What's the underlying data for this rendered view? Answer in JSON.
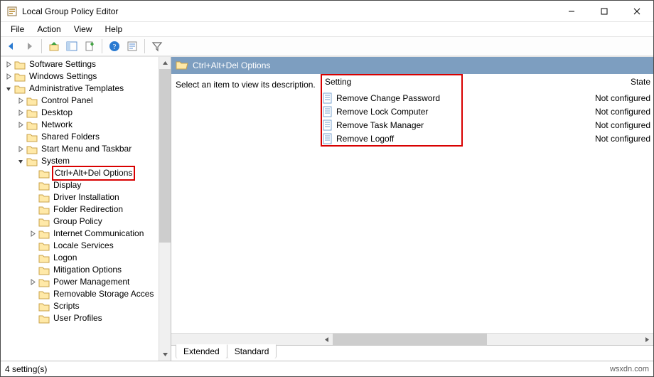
{
  "window": {
    "title": "Local Group Policy Editor"
  },
  "menu": {
    "file": "File",
    "action": "Action",
    "view": "View",
    "help": "Help"
  },
  "tree": {
    "software_settings": "Software Settings",
    "windows_settings": "Windows Settings",
    "admin_templates": "Administrative Templates",
    "control_panel": "Control Panel",
    "desktop": "Desktop",
    "network": "Network",
    "shared_folders": "Shared Folders",
    "start_menu_taskbar": "Start Menu and Taskbar",
    "system": "System",
    "ctrl_alt_del": "Ctrl+Alt+Del Options",
    "display": "Display",
    "driver_installation": "Driver Installation",
    "folder_redirection": "Folder Redirection",
    "group_policy": "Group Policy",
    "internet_comm": "Internet Communication",
    "locale_services": "Locale Services",
    "logon": "Logon",
    "mitigation_options": "Mitigation Options",
    "power_management": "Power Management",
    "removable_storage": "Removable Storage Acces",
    "scripts": "Scripts",
    "user_profiles": "User Profiles"
  },
  "right": {
    "header": "Ctrl+Alt+Del Options",
    "description_prompt": "Select an item to view its description.",
    "columns": {
      "setting": "Setting",
      "state": "State"
    },
    "rows": [
      {
        "name": "Remove Change Password",
        "state": "Not configured"
      },
      {
        "name": "Remove Lock Computer",
        "state": "Not configured"
      },
      {
        "name": "Remove Task Manager",
        "state": "Not configured"
      },
      {
        "name": "Remove Logoff",
        "state": "Not configured"
      }
    ]
  },
  "tabs": {
    "extended": "Extended",
    "standard": "Standard"
  },
  "statusbar": {
    "text": "4 setting(s)"
  },
  "watermark": "wsxdn.com"
}
